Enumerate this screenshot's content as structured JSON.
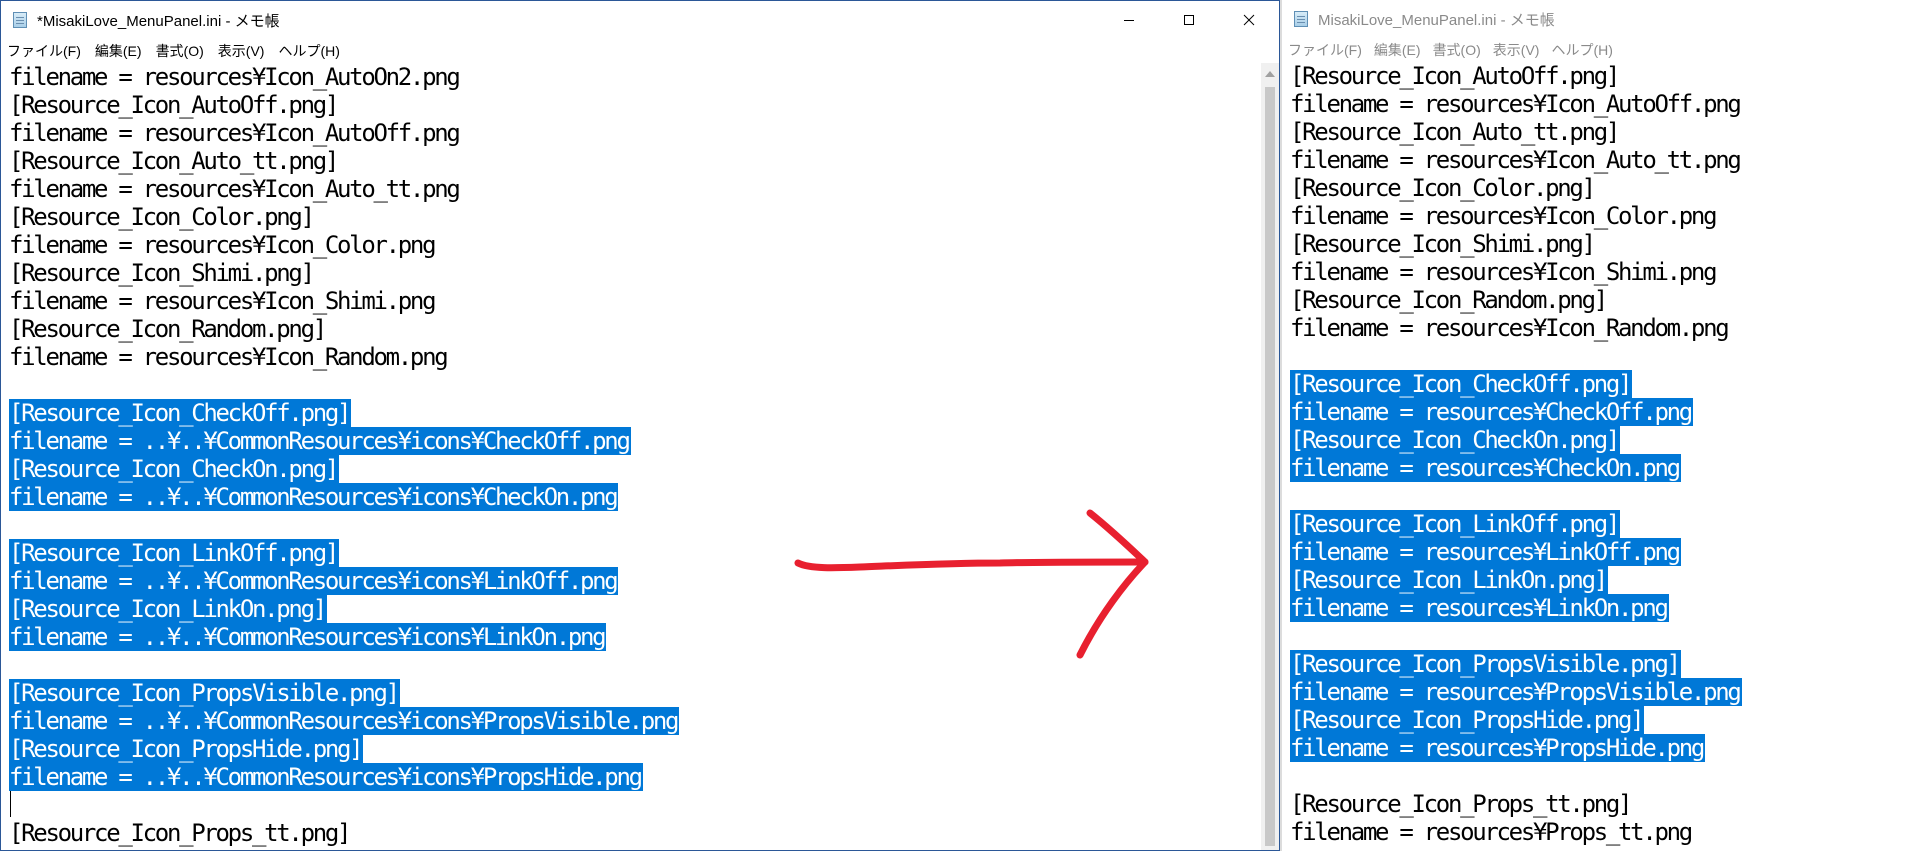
{
  "left_window": {
    "title": "*MisakiLove_MenuPanel.ini - メモ帳",
    "menu": [
      "ファイル(F)",
      "編集(E)",
      "書式(O)",
      "表示(V)",
      "ヘルプ(H)"
    ],
    "lines": [
      {
        "text": "filename = resources¥Icon_AutoOn2.png",
        "selected": false
      },
      {
        "text": "[Resource_Icon_AutoOff.png]",
        "selected": false
      },
      {
        "text": "filename = resources¥Icon_AutoOff.png",
        "selected": false
      },
      {
        "text": "[Resource_Icon_Auto_tt.png]",
        "selected": false
      },
      {
        "text": "filename = resources¥Icon_Auto_tt.png",
        "selected": false
      },
      {
        "text": "[Resource_Icon_Color.png]",
        "selected": false
      },
      {
        "text": "filename = resources¥Icon_Color.png",
        "selected": false
      },
      {
        "text": "[Resource_Icon_Shimi.png]",
        "selected": false
      },
      {
        "text": "filename = resources¥Icon_Shimi.png",
        "selected": false
      },
      {
        "text": "[Resource_Icon_Random.png]",
        "selected": false
      },
      {
        "text": "filename = resources¥Icon_Random.png",
        "selected": false
      },
      {
        "text": "",
        "selected": false
      },
      {
        "text": "[Resource_Icon_CheckOff.png]",
        "selected": true
      },
      {
        "text": "filename = ..¥..¥CommonResources¥icons¥CheckOff.png",
        "selected": true
      },
      {
        "text": "[Resource_Icon_CheckOn.png]",
        "selected": true
      },
      {
        "text": "filename = ..¥..¥CommonResources¥icons¥CheckOn.png",
        "selected": true
      },
      {
        "text": "",
        "selected": false
      },
      {
        "text": "[Resource_Icon_LinkOff.png]",
        "selected": true
      },
      {
        "text": "filename = ..¥..¥CommonResources¥icons¥LinkOff.png",
        "selected": true
      },
      {
        "text": "[Resource_Icon_LinkOn.png]",
        "selected": true
      },
      {
        "text": "filename = ..¥..¥CommonResources¥icons¥LinkOn.png",
        "selected": true
      },
      {
        "text": "",
        "selected": false
      },
      {
        "text": "[Resource_Icon_PropsVisible.png]",
        "selected": true
      },
      {
        "text": "filename = ..¥..¥CommonResources¥icons¥PropsVisible.png",
        "selected": true
      },
      {
        "text": "[Resource_Icon_PropsHide.png]",
        "selected": true
      },
      {
        "text": "filename = ..¥..¥CommonResources¥icons¥PropsHide.png",
        "selected": true
      },
      {
        "text": "",
        "selected": false
      },
      {
        "text": "[Resource_Icon_Props_tt.png]",
        "selected": false
      },
      {
        "text": "filename = resources¥Props_tt.png",
        "selected": false
      }
    ]
  },
  "right_window": {
    "title": "MisakiLove_MenuPanel.ini - メモ帳",
    "menu": [
      "ファイル(F)",
      "編集(E)",
      "書式(O)",
      "表示(V)",
      "ヘルプ(H)"
    ],
    "lines": [
      {
        "text": "[Resource_Icon_AutoOff.png]",
        "selected": false
      },
      {
        "text": "filename = resources¥Icon_AutoOff.png",
        "selected": false
      },
      {
        "text": "[Resource_Icon_Auto_tt.png]",
        "selected": false
      },
      {
        "text": "filename = resources¥Icon_Auto_tt.png",
        "selected": false
      },
      {
        "text": "[Resource_Icon_Color.png]",
        "selected": false
      },
      {
        "text": "filename = resources¥Icon_Color.png",
        "selected": false
      },
      {
        "text": "[Resource_Icon_Shimi.png]",
        "selected": false
      },
      {
        "text": "filename = resources¥Icon_Shimi.png",
        "selected": false
      },
      {
        "text": "[Resource_Icon_Random.png]",
        "selected": false
      },
      {
        "text": "filename = resources¥Icon_Random.png",
        "selected": false
      },
      {
        "text": "",
        "selected": false
      },
      {
        "text": "[Resource_Icon_CheckOff.png]",
        "selected": true
      },
      {
        "text": "filename = resources¥CheckOff.png",
        "selected": true
      },
      {
        "text": "[Resource_Icon_CheckOn.png]",
        "selected": true
      },
      {
        "text": "filename = resources¥CheckOn.png",
        "selected": true
      },
      {
        "text": "",
        "selected": false
      },
      {
        "text": "[Resource_Icon_LinkOff.png]",
        "selected": true
      },
      {
        "text": "filename = resources¥LinkOff.png",
        "selected": true
      },
      {
        "text": "[Resource_Icon_LinkOn.png]",
        "selected": true
      },
      {
        "text": "filename = resources¥LinkOn.png",
        "selected": true
      },
      {
        "text": "",
        "selected": false
      },
      {
        "text": "[Resource_Icon_PropsVisible.png]",
        "selected": true
      },
      {
        "text": "filename = resources¥PropsVisible.png",
        "selected": true
      },
      {
        "text": "[Resource_Icon_PropsHide.png]",
        "selected": true
      },
      {
        "text": "filename = resources¥PropsHide.png",
        "selected": true
      },
      {
        "text": "",
        "selected": false
      },
      {
        "text": "[Resource_Icon_Props_tt.png]",
        "selected": false
      },
      {
        "text": "filename = resources¥Props_tt.png",
        "selected": false
      }
    ]
  },
  "colors": {
    "selection": "#0078d7",
    "annotation_arrow": "#e8202f"
  },
  "icons": {
    "app": "notepad-icon",
    "minimize": "minimize-icon",
    "maximize": "maximize-icon",
    "close": "close-icon",
    "annotation": "red-arrow-right"
  }
}
